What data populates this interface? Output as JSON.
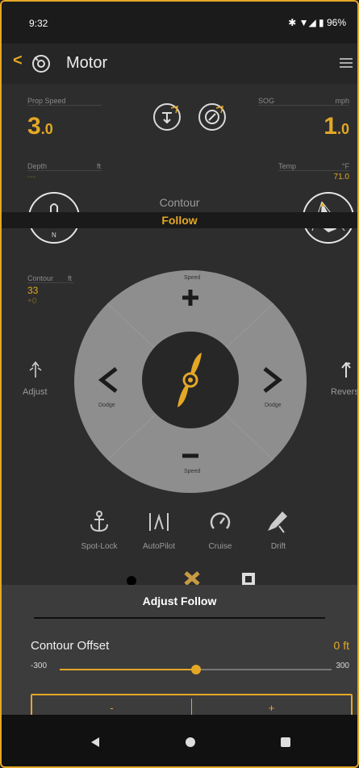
{
  "status": {
    "time": "9:32",
    "battery": "96%",
    "indicators": "✱ ▼◢ ▮"
  },
  "appbar": {
    "back": "<",
    "title": "Motor"
  },
  "readings": {
    "prop_speed": {
      "label": "Prop Speed",
      "value_int": "3",
      "value_dec": ".0"
    },
    "sog": {
      "label": "SOG",
      "unit": "mph",
      "value_int": "1",
      "value_dec": ".0"
    },
    "depth": {
      "label": "Depth",
      "unit": "ft",
      "value": "---"
    },
    "temp": {
      "label": "Temp",
      "unit": "°F",
      "value": "71.0"
    },
    "contour": {
      "label": "Contour",
      "unit": "ft",
      "value": "33",
      "sub": "+0"
    }
  },
  "mode_banner": {
    "title": "Contour",
    "subtitle": "Follow"
  },
  "wheel": {
    "speed_top": "Speed",
    "speed_bottom": "Speed",
    "dodge_left": "Dodge",
    "dodge_right": "Dodge"
  },
  "side": {
    "adjust": "Adjust",
    "reverse": "Reverse"
  },
  "modes": [
    {
      "label": "Spot-Lock",
      "icon": "anchor-icon"
    },
    {
      "label": "AutoPilot",
      "icon": "autopilot-icon"
    },
    {
      "label": "Cruise",
      "icon": "gauge-icon"
    },
    {
      "label": "Drift",
      "icon": "drift-icon"
    }
  ],
  "panel": {
    "title": "Adjust Follow",
    "offset_label": "Contour Offset",
    "offset_value": "0 ft",
    "min": "-300",
    "max": "300",
    "slider_fraction": 0.5,
    "minus": "-",
    "plus": "+"
  },
  "colors": {
    "accent": "#e4a826",
    "background": "#2d2d2d",
    "panel": "#3c3c3c"
  }
}
